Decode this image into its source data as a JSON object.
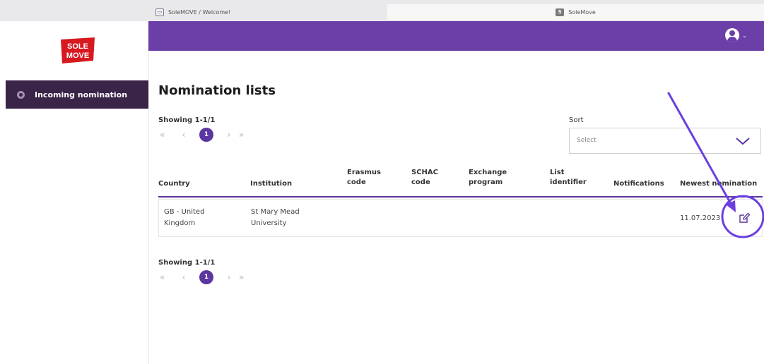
{
  "browser": {
    "tabs": [
      {
        "label": "SoleMOVE / Welcome!"
      },
      {
        "label": "SoleMove",
        "icon_letter": "S"
      }
    ]
  },
  "sidebar": {
    "logo": {
      "line1": "SOLE",
      "line2": "MOVE",
      "color": "#d71920"
    },
    "items": [
      {
        "label": "Incoming nomination",
        "active": true
      }
    ]
  },
  "header": {
    "color": "#6b3fa7",
    "user_menu_chevron": "⌄"
  },
  "page": {
    "title": "Nomination lists",
    "showing_top": "Showing 1-1/1",
    "showing_bottom": "Showing 1-1/1",
    "pager": {
      "first": "«",
      "prev": "‹",
      "current": "1",
      "next": "›",
      "last": "»"
    },
    "sort": {
      "label": "Sort",
      "placeholder": "Select"
    }
  },
  "table": {
    "headers": {
      "country": "Country",
      "institution": "Institution",
      "erasmus_line1": "Erasmus",
      "erasmus_line2": "code",
      "schac_line1": "SCHAC",
      "schac_line2": "code",
      "exchange_line1": "Exchange",
      "exchange_line2": "program",
      "list_line1": "List",
      "list_line2": "identifier",
      "notifications": "Notifications",
      "newest": "Newest nomination"
    },
    "rows": [
      {
        "country_line1": "GB - United",
        "country_line2": "Kingdom",
        "institution_line1": "St Mary Mead",
        "institution_line2": "University",
        "newest": "11.07.2023"
      }
    ]
  },
  "colors": {
    "accent": "#5b35a0",
    "annotation": "#6a3fe0",
    "sidebar_active": "#3a2448"
  },
  "icons": [
    "user-avatar-icon",
    "edit-icon",
    "chevron-down-icon",
    "nomination-icon"
  ]
}
